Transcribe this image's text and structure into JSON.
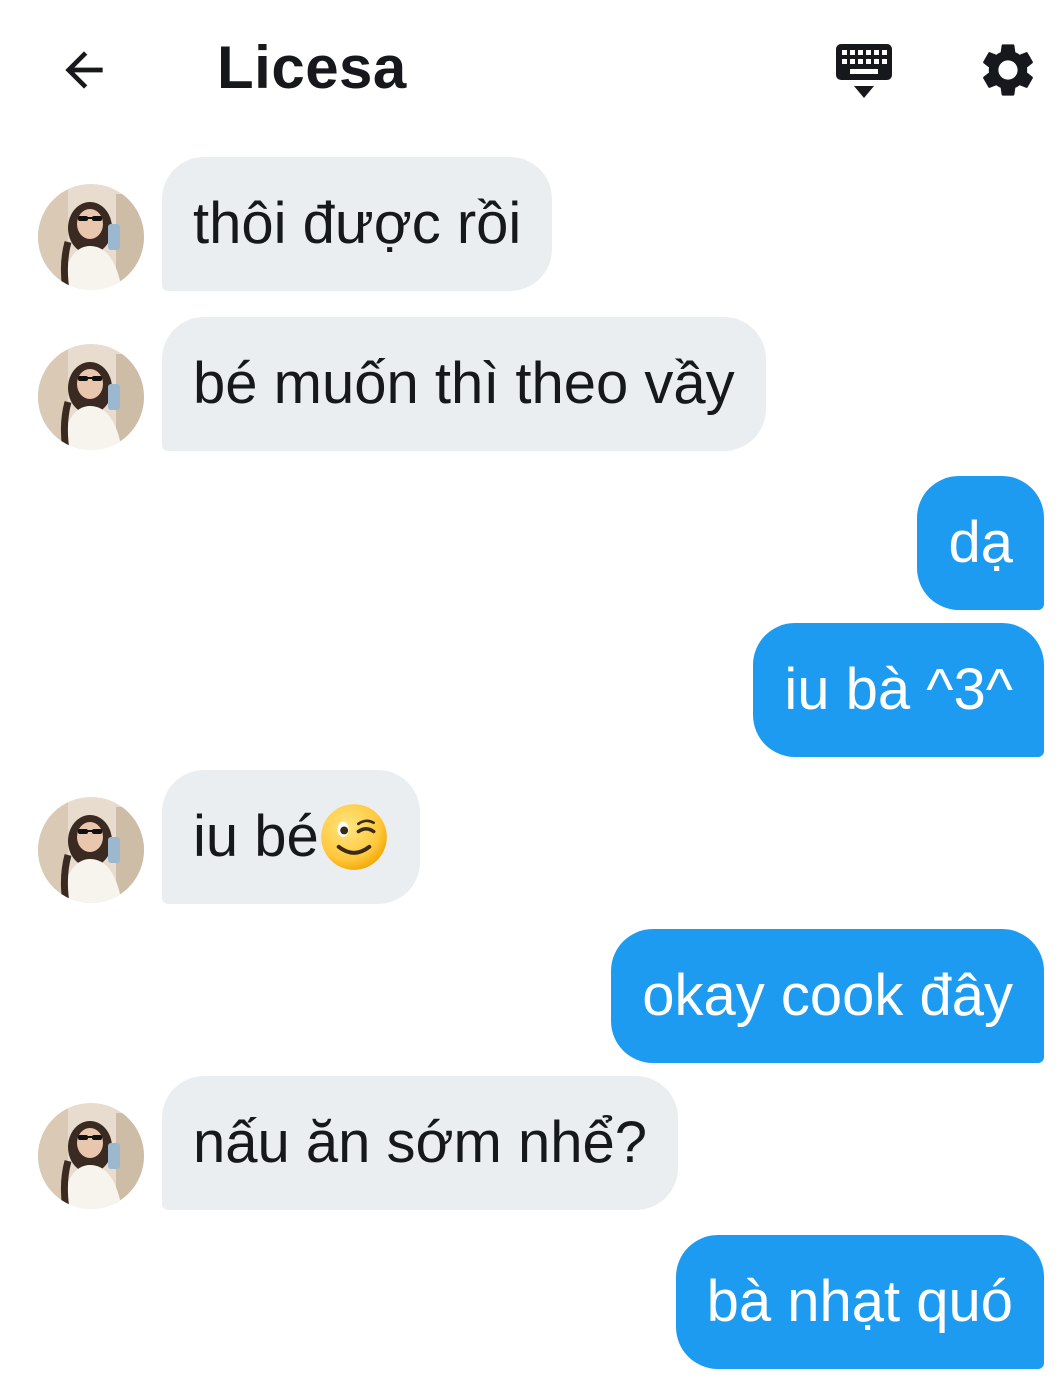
{
  "header": {
    "title": "Licesa",
    "back_icon": "arrow-left-icon",
    "keyboard_icon": "keyboard-icon",
    "settings_icon": "gear-icon"
  },
  "colors": {
    "outgoing_bubble": "#1d9bf0",
    "incoming_bubble": "#ebeef0",
    "text": "#16181c"
  },
  "messages": [
    {
      "direction": "incoming",
      "text": "thôi được rồi"
    },
    {
      "direction": "incoming",
      "text": "bé muốn thì theo vầy"
    },
    {
      "direction": "outgoing",
      "text": "dạ"
    },
    {
      "direction": "outgoing",
      "text": "iu bà ^3^"
    },
    {
      "direction": "incoming",
      "text": "iu bé",
      "emoji": "winking-face"
    },
    {
      "direction": "outgoing",
      "text": "okay cook đây"
    },
    {
      "direction": "incoming",
      "text": "nấu ăn sớm nhể?"
    },
    {
      "direction": "outgoing",
      "text": "bà nhạt quó"
    }
  ]
}
